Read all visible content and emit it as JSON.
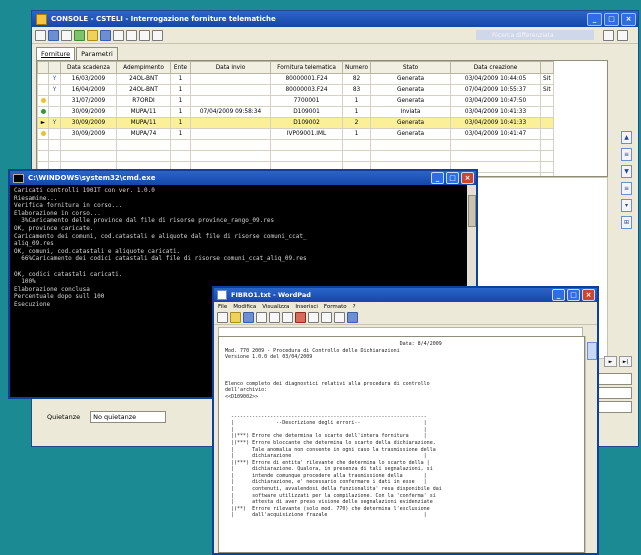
{
  "main": {
    "title": "CONSOLE - CSTELI - Interrogazione forniture telematiche",
    "search_label": "Ricerca differenziata",
    "tabs": [
      "Forniture",
      "Parametri"
    ],
    "columns": [
      "Data scadenza",
      "Adempimento",
      "Ente",
      "Data invio",
      "Fornitura telematica",
      "Numero",
      "Stato",
      "Data creazione"
    ],
    "rows": [
      {
        "status": "",
        "flag": "Y",
        "cells": [
          "16/03/2009",
          "24OL-BNT",
          "1",
          "",
          "80000001.F24",
          "82",
          "Generata",
          "03/04/2009 10:44:05"
        ],
        "extra": "Sit",
        "selected": false
      },
      {
        "status": "",
        "flag": "Y",
        "cells": [
          "16/04/2009",
          "24OL-BNT",
          "1",
          "",
          "80000003.F24",
          "83",
          "Generata",
          "07/04/2009 10:55:37"
        ],
        "extra": "Sit",
        "selected": false
      },
      {
        "status": "yellow",
        "flag": "",
        "cells": [
          "31/07/2009",
          "R7ORDI",
          "1",
          "",
          "7700001",
          "1",
          "Generata",
          "03/04/2009 10:47:50"
        ],
        "extra": "",
        "selected": false
      },
      {
        "status": "green",
        "flag": "",
        "cells": [
          "30/09/2009",
          "MUPA/11",
          "1",
          "07/04/2009 09:58:34",
          "D109001",
          "1",
          "Inviata",
          "03/04/2009 10:41:33"
        ],
        "extra": "",
        "selected": false
      },
      {
        "status": "yellow",
        "flag": "Y",
        "cells": [
          "30/09/2009",
          "MUPA/11",
          "1",
          "",
          "D109002",
          "2",
          "Generata",
          "03/04/2009 10:41:33"
        ],
        "extra": "",
        "selected": true
      },
      {
        "status": "yellow",
        "flag": "",
        "cells": [
          "30/09/2009",
          "MUPA/74",
          "1",
          "",
          "IVP09001.IML",
          "1",
          "Generata",
          "03/04/2009 10:41:47"
        ],
        "extra": "",
        "selected": false
      }
    ],
    "bottom_label": "Quietanze",
    "bottom_value": "No quietanze"
  },
  "cmd": {
    "title": "C:\\WINDOWS\\system32\\cmd.exe",
    "lines": [
      "Caricati controlli 190IT con ver. 1.0.0",
      "Riesamine...",
      "Verifica fornitura in corso...",
      "Elaborazione in corso...",
      "  3%Caricamento delle province dal file di risorse province_rango_09.res",
      "OK, province caricate.",
      "Caricamento dei comuni, cod.catastali e aliquote dal file di risorse comuni_ccat_",
      "aliq_09.res",
      "OK, comuni, cod.catastali e aliquote caricati.",
      "  66%Caricamento dei codici catastali dal file di risorse comuni_ccat_aliq_09.res",
      "",
      "OK, codici catastali caricati.",
      "  100%",
      "Elaborazione conclusa",
      "Percentuale dopo sull 100",
      "Esecuzione"
    ]
  },
  "wordpad": {
    "title": "FIBRO1.txt - WordPad",
    "menu": [
      "File",
      "Modifica",
      "Visualizza",
      "Inserisci",
      "Formato",
      "?"
    ],
    "text": "                                                          Data: 8/4/2009\nMod. 770 2009 - Procedura di Controllo delle Dichiarazioni\nVersione 1.0.0 del 03/04/2009\n\n\n\nElenco completo dei diagnostici relativi alla procedura di controllo\ndell'archivio:\n<<D109002>>\n\n\n  -----------------------------------------------------------------\n  |              --Descrizione degli errori--                     |\n  |                                                               |\n  |(***) Errore che determina lo scarto dell'intera fornitura     |\n  |(***) Errore bloccante che determina lo scarto della dichiarazione.\n  |      Tale anomalia non consente in ogni caso la trasmissione della\n  |      dichiarazione                                            |\n  |(***) Errore di entita' rilevante che determina lo scarto della |\n  |      dichiarazione. Qualora, in presenza di tali segnalazioni, si\n  |      intende comunque procedere alla trasmissione della       |\n  |      dichiarazione, e' necessario confermare i dati in esse   |\n  |      contenuti, avvalendosi della funzionalita' resa disponibile dai\n  |      software utilizzati per la compilazione. Con la 'conferma' si\n  |      attesta di aver preso visione delle segnalazioni evidenziate\n  |(**)  Errore rilevante (solo mod. 770) che determina l'esclusione\n  |      dall'acquisizione frazale                                |"
  }
}
